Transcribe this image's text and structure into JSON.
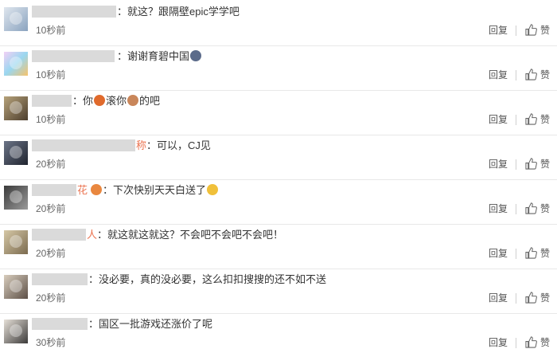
{
  "comments": [
    {
      "name_tail": "",
      "text": "：就这？跟隔壁epic学学吧",
      "emojis": [],
      "time": "10秒前"
    },
    {
      "name_tail": "",
      "text": "：谢谢育碧中国",
      "emojis": [
        {
          "color": "#5b6b8a"
        }
      ],
      "time": "10秒前"
    },
    {
      "name_tail": "",
      "text": "：你",
      "mid": "滚你",
      "end": "的吧",
      "emojis": [
        {
          "color": "#e06a2c"
        },
        {
          "color": "#c9865a"
        }
      ],
      "time": "10秒前"
    },
    {
      "name_tail": "称",
      "text": "：可以，CJ见",
      "emojis": [],
      "time": "20秒前"
    },
    {
      "name_tail": "花",
      "text": "：下次快别天天白送了",
      "emojis": [
        {
          "color": "#f0c03a"
        }
      ],
      "pre_emoji": {
        "color": "#e9873f"
      },
      "time": "20秒前"
    },
    {
      "name_tail": "人",
      "text": "：就这就这就这？不会吧不会吧不会吧！",
      "emojis": [],
      "time": "20秒前"
    },
    {
      "name_tail": "",
      "text": "：没必要，真的没必要，这么扣扣搜搜的还不如不送",
      "emojis": [],
      "time": "20秒前"
    },
    {
      "name_tail": "",
      "text": "：国区一批游戏还涨价了呢",
      "emojis": [],
      "time": "30秒前"
    }
  ],
  "actions": {
    "reply": "回复",
    "like": "赞"
  },
  "colors": {
    "username": "#eb7350",
    "divider": "#e8e8e8"
  }
}
